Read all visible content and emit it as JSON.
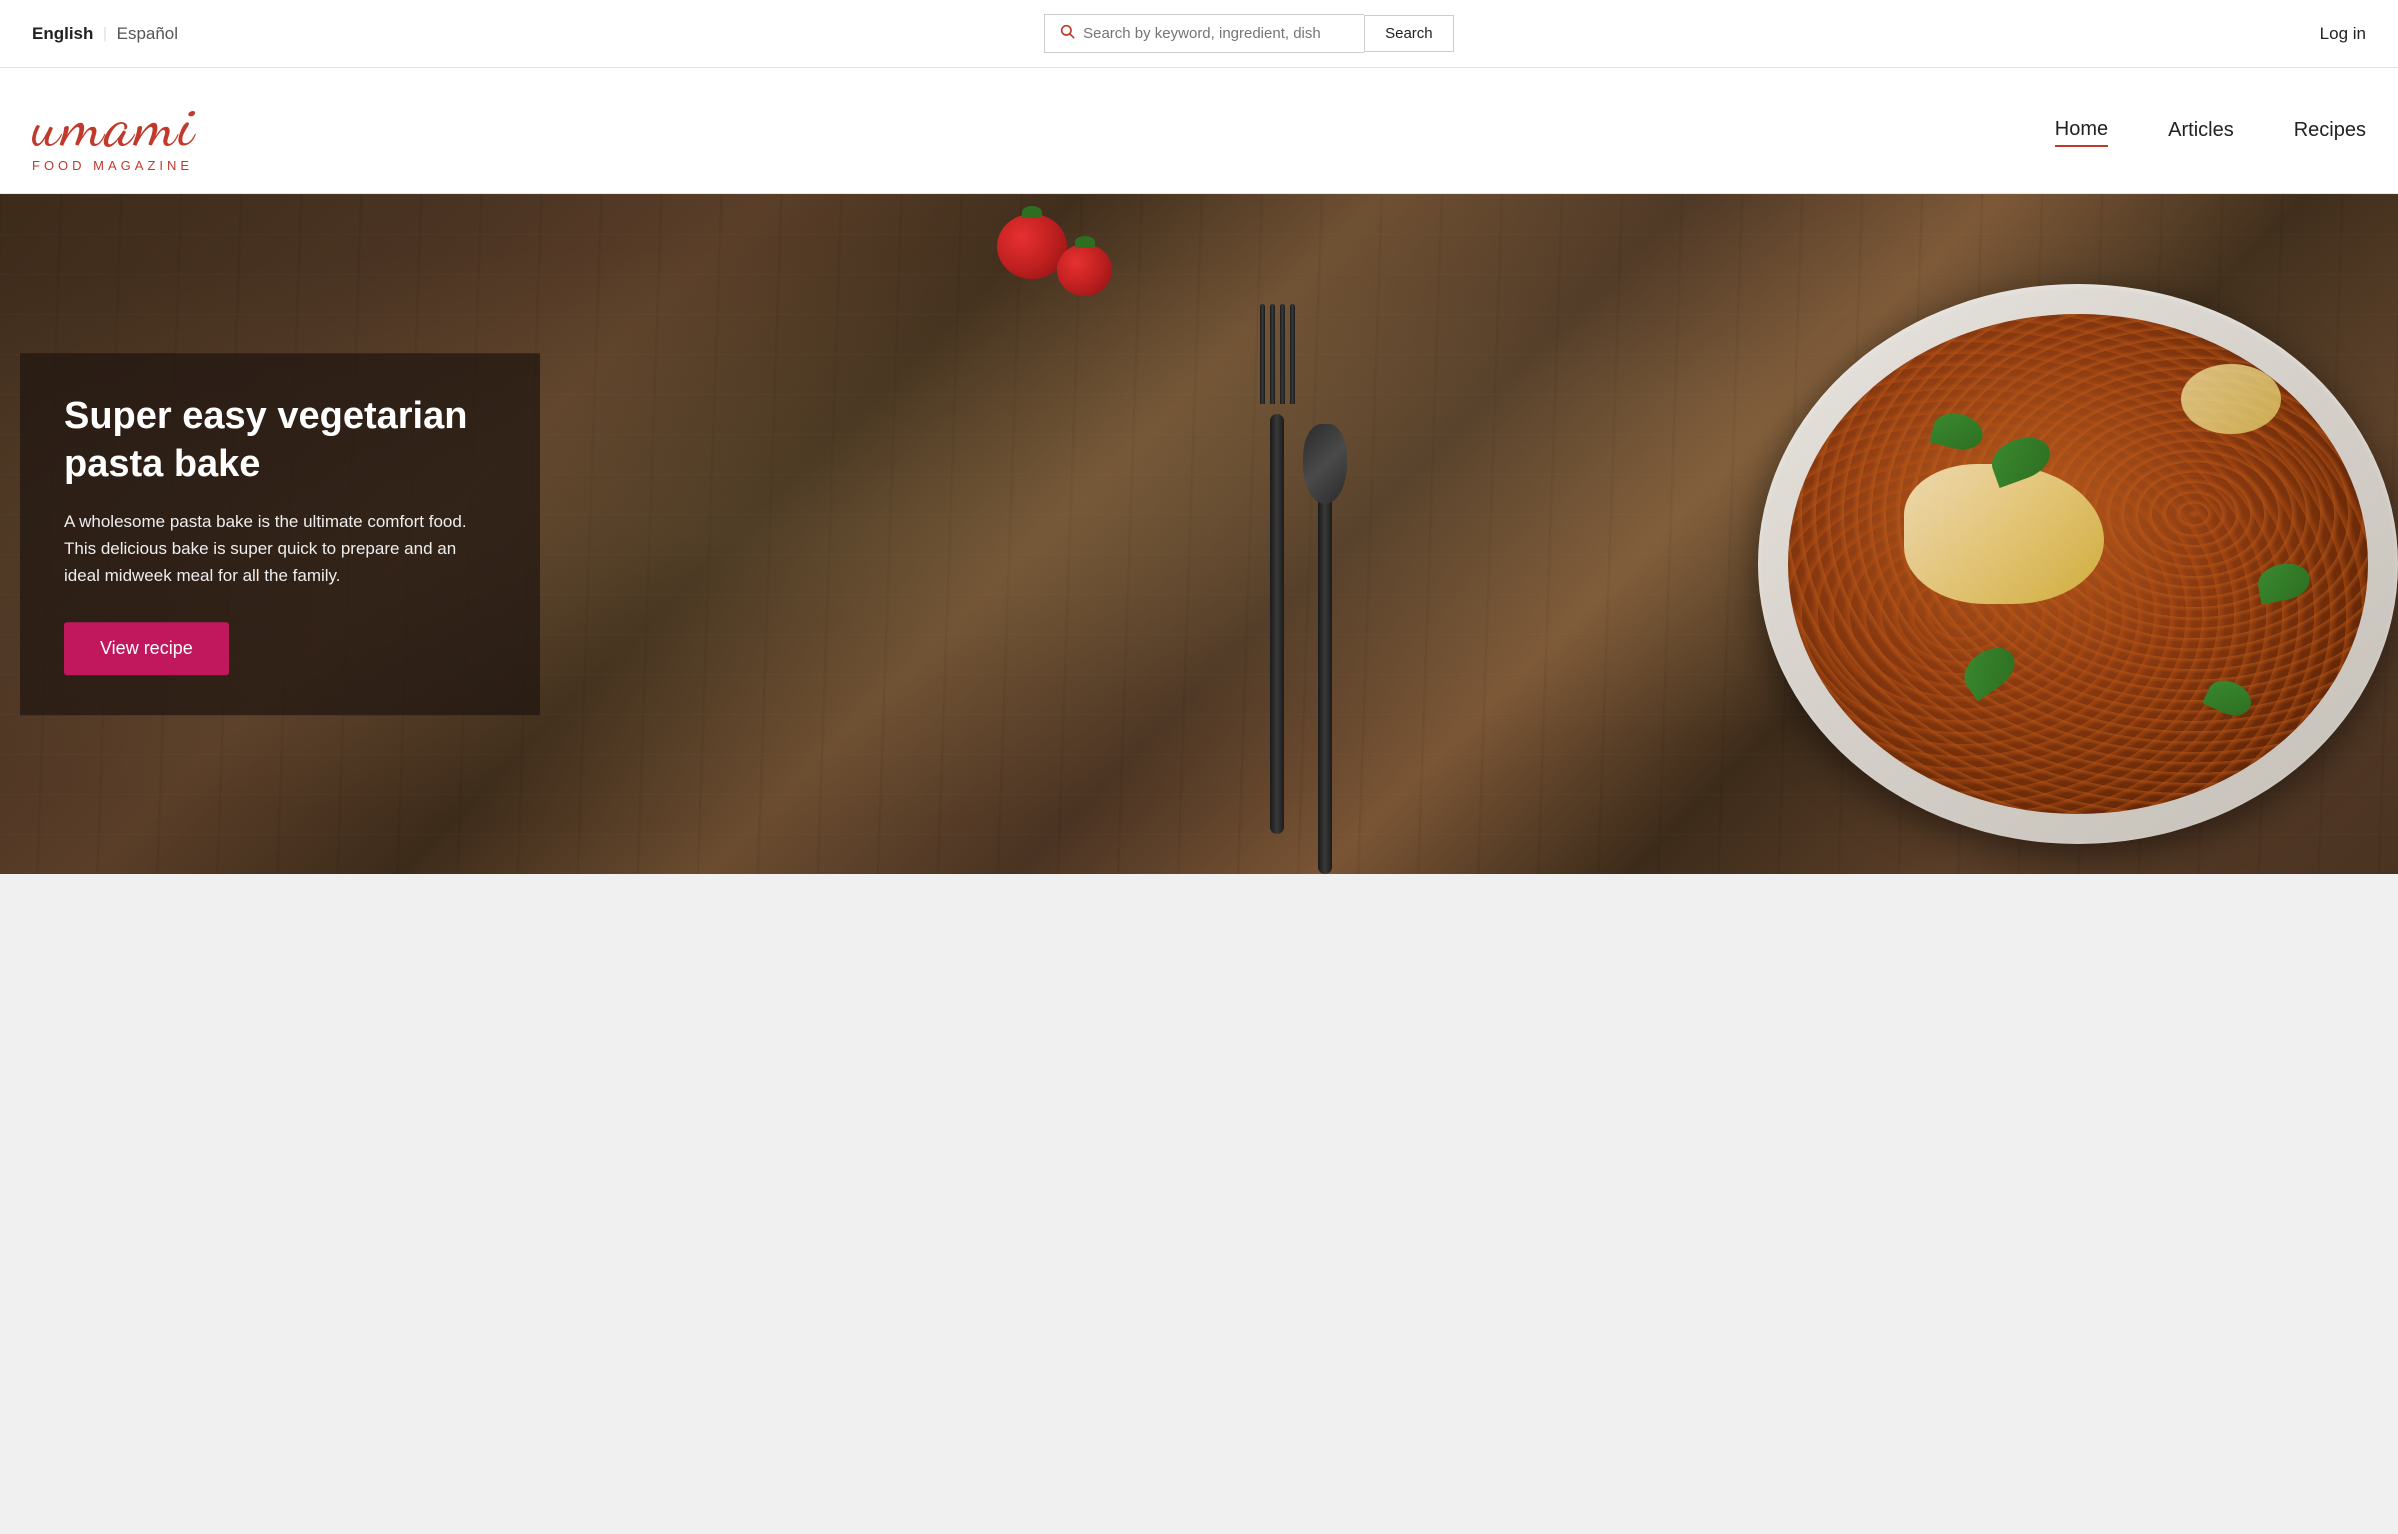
{
  "topbar": {
    "lang_english": "English",
    "lang_espanol": "Español",
    "search_placeholder": "Search by keyword, ingredient, dish",
    "search_button_label": "Search",
    "login_label": "Log in"
  },
  "header": {
    "logo_text": "umami",
    "logo_subtitle": "FOOD MAGAZINE",
    "nav": [
      {
        "id": "home",
        "label": "Home",
        "active": true
      },
      {
        "id": "articles",
        "label": "Articles",
        "active": false
      },
      {
        "id": "recipes",
        "label": "Recipes",
        "active": false
      }
    ]
  },
  "hero": {
    "title": "Super easy vegetarian pasta bake",
    "description": "A wholesome pasta bake is the ultimate comfort food. This delicious bake is super quick to prepare and an ideal midweek meal for all the family.",
    "cta_label": "View recipe",
    "colors": {
      "cta_bg": "#c0175d",
      "overlay_bg": "rgba(30,20,15,0.7)"
    }
  },
  "icons": {
    "search": "🔍",
    "search_pink": "&#128269;"
  }
}
